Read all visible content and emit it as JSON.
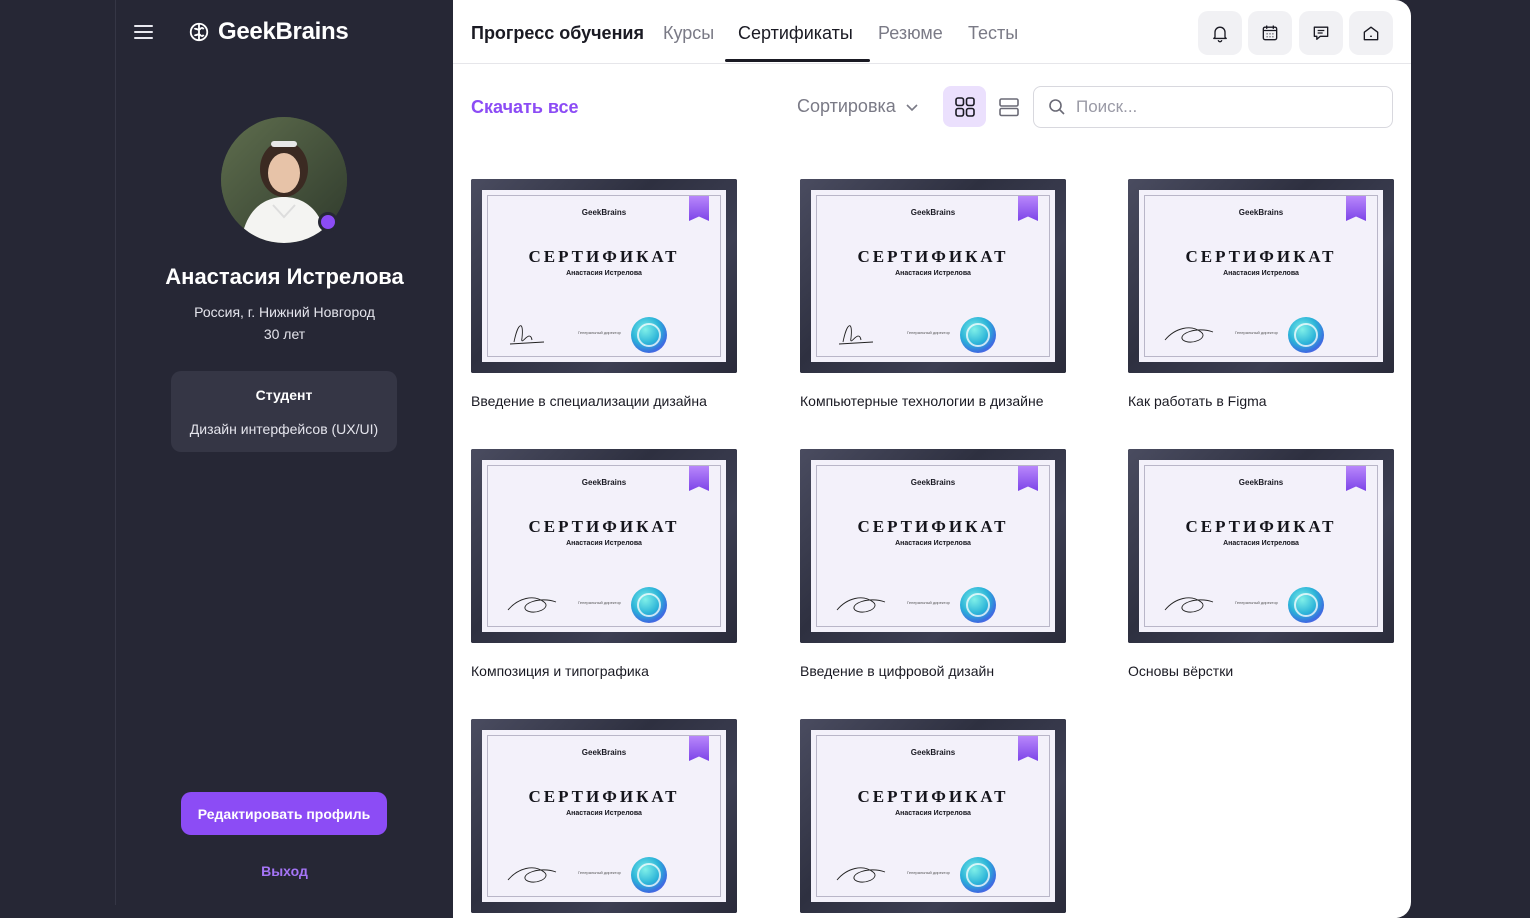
{
  "brand": {
    "name": "GeekBrains",
    "accent": "#8c4cf5"
  },
  "sidebar": {
    "menu_icon": "hamburger-icon",
    "user": {
      "name": "Анастасия Истрелова",
      "location": "Россия, г. Нижний Новгород",
      "age": "30 лет",
      "status": "online"
    },
    "role": {
      "title": "Студент",
      "specialization": "Дизайн интерфейсов (UX/UI)"
    },
    "edit_profile_label": "Редактировать профиль",
    "logout_label": "Выход"
  },
  "tabs": [
    {
      "label": "Прогресс обучения",
      "active": false
    },
    {
      "label": "Курсы",
      "active": false
    },
    {
      "label": "Сертификаты",
      "active": true
    },
    {
      "label": "Резюме",
      "active": false
    },
    {
      "label": "Тесты",
      "active": false
    }
  ],
  "top_icons": [
    "bell-icon",
    "calendar-icon",
    "chat-icon",
    "home-icon"
  ],
  "toolbar": {
    "download_all_label": "Скачать все",
    "sort_label": "Сортировка",
    "view_mode": "grid",
    "search_placeholder": "Поиск..."
  },
  "certificate_template": {
    "logo_text": "GeekBrains",
    "heading": "СЕРТИФИКАТ",
    "recipient": "Анастасия Истрелова",
    "director_label": "Генеральный директор"
  },
  "certificates": [
    {
      "caption": "Введение в специализации дизайна"
    },
    {
      "caption": "Компьютерные технологии в дизайне"
    },
    {
      "caption": "Как работать в Figma"
    },
    {
      "caption": "Композиция и типографика"
    },
    {
      "caption": "Введение в цифровой дизайн"
    },
    {
      "caption": "Основы вёрстки"
    },
    {
      "caption": ""
    },
    {
      "caption": ""
    }
  ]
}
